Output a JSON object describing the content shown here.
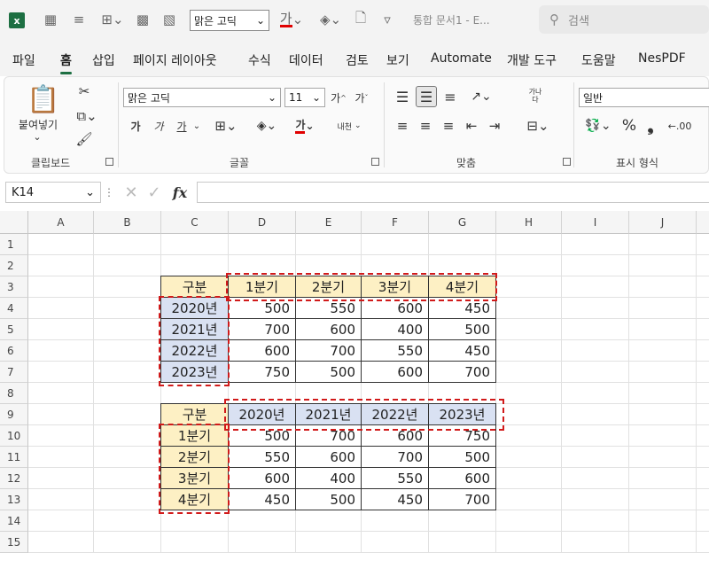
{
  "qat": {
    "excel_logo": "x",
    "font_name": "맑은 고딕",
    "font_color_label": "가",
    "doc_title": "통합 문서1 - E...",
    "search_placeholder": "검색"
  },
  "tabs": [
    "파일",
    "홈",
    "삽입",
    "페이지 레이아웃",
    "수식",
    "데이터",
    "검토",
    "보기",
    "Automate",
    "개발 도구",
    "도움말",
    "NesPDF"
  ],
  "active_tab": "홈",
  "ribbon": {
    "paste_label": "붙여넣기",
    "font_name": "맑은 고딕",
    "font_size": "11",
    "bold": "가",
    "italic": "가",
    "underline": "가",
    "font_color": "가",
    "wrap_text": "가나\n다",
    "phonetic": "내천",
    "number_format": "일반",
    "percent": "%",
    "comma": "❟",
    "groups": {
      "clipboard": "클립보드",
      "font": "글꼴",
      "alignment": "맞춤",
      "number": "표시 형식"
    }
  },
  "formula_bar": {
    "name_box": "K14",
    "fx": "fx"
  },
  "columns": [
    "A",
    "B",
    "C",
    "D",
    "E",
    "F",
    "G",
    "H",
    "I",
    "J"
  ],
  "rows": [
    "1",
    "2",
    "3",
    "4",
    "5",
    "6",
    "7",
    "8",
    "9",
    "10",
    "11",
    "12",
    "13",
    "14",
    "15"
  ],
  "table1": {
    "corner": "구분",
    "quarters": [
      "1분기",
      "2분기",
      "3분기",
      "4분기"
    ],
    "years": [
      "2020년",
      "2021년",
      "2022년",
      "2023년"
    ],
    "values": [
      [
        500,
        550,
        600,
        450
      ],
      [
        700,
        600,
        400,
        500
      ],
      [
        600,
        700,
        550,
        450
      ],
      [
        750,
        500,
        600,
        700
      ]
    ]
  },
  "table2": {
    "corner": "구분",
    "years": [
      "2020년",
      "2021년",
      "2022년",
      "2023년"
    ],
    "quarters": [
      "1분기",
      "2분기",
      "3분기",
      "4분기"
    ],
    "values": [
      [
        500,
        700,
        600,
        750
      ],
      [
        550,
        600,
        700,
        500
      ],
      [
        600,
        400,
        550,
        600
      ],
      [
        450,
        500,
        450,
        700
      ]
    ]
  },
  "colors": {
    "excel_green": "#1d6f42",
    "header_yellow": "#fdf0c4",
    "header_blue": "#d9e1f2",
    "dashed_red": "#d11a1a"
  }
}
